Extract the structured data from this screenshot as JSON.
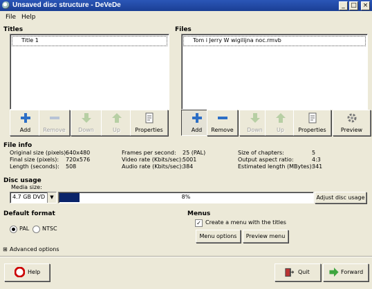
{
  "window": {
    "title": "Unsaved disc structure - DeVeDe",
    "minimize": "_",
    "maximize": "□",
    "close": "×"
  },
  "menu": {
    "file": "File",
    "help": "Help"
  },
  "titles": {
    "heading": "Titles",
    "items": [
      "Title 1"
    ],
    "buttons": {
      "add": "Add",
      "remove": "Remove",
      "down": "Down",
      "up": "Up",
      "properties": "Properties"
    }
  },
  "files": {
    "heading": "Files",
    "items": [
      "Tom i Jerry W wigilijna  noc.rmvb"
    ],
    "buttons": {
      "add": "Add",
      "remove": "Remove",
      "down": "Down",
      "up": "Up",
      "properties": "Properties",
      "preview": "Preview"
    }
  },
  "file_info": {
    "heading": "File info",
    "original_size_label": "Original size (pixels):",
    "original_size": "640x480",
    "final_size_label": "Final size (pixels):",
    "final_size": "720x576",
    "length_label": "Length (seconds):",
    "length": "508",
    "fps_label": "Frames per second:",
    "fps": "25 (PAL)",
    "video_rate_label": "Video rate (Kbits/sec):",
    "video_rate": "5001",
    "audio_rate_label": "Audio rate (Kbits/sec):",
    "audio_rate": "384",
    "chapters_label": "Size of chapters:",
    "chapters": "5",
    "aspect_label": "Output aspect ratio:",
    "aspect": "4:3",
    "est_length_label": "Estimated length (MBytes):",
    "est_length": "341"
  },
  "disc_usage": {
    "heading": "Disc usage",
    "media_size_label": "Media size:",
    "media_size": "4.7 GB DVD",
    "usage_percent": 8,
    "usage_text": "8%",
    "adjust_button": "Adjust disc usage"
  },
  "default_format": {
    "heading": "Default format",
    "pal": "PAL",
    "ntsc": "NTSC",
    "selected": "PAL"
  },
  "menus": {
    "heading": "Menus",
    "create_menu_label": "Create a menu with the titles",
    "create_menu_checked": true,
    "menu_options": "Menu options",
    "preview_menu": "Preview menu"
  },
  "advanced": {
    "label": "Advanced options"
  },
  "footer": {
    "help": "Help",
    "quit": "Quit",
    "forward": "Forward"
  },
  "colors": {
    "titlebar": "#2b56b7",
    "progress_fill": "#0a246a",
    "face": "#ece9d8"
  }
}
